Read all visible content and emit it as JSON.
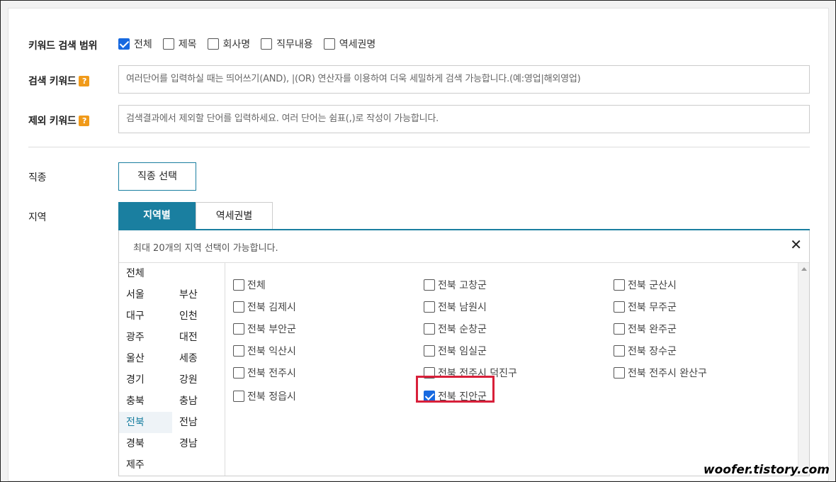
{
  "scope": {
    "label": "키워드 검색 범위",
    "options": [
      {
        "label": "전체",
        "checked": true
      },
      {
        "label": "제목",
        "checked": false
      },
      {
        "label": "회사명",
        "checked": false
      },
      {
        "label": "직무내용",
        "checked": false
      },
      {
        "label": "역세권명",
        "checked": false
      }
    ]
  },
  "search_keyword": {
    "label": "검색 키워드",
    "help": "?",
    "placeholder": "여러단어를 입력하실 때는 띄어쓰기(AND), |(OR) 연산자를 이용하여 더욱 세밀하게 검색 가능합니다.(예:영업|해외영업)"
  },
  "exclude_keyword": {
    "label": "제외 키워드",
    "help": "?",
    "placeholder": "검색결과에서 제외할 단어를 입력하세요. 여러 단어는 쉼표(,)로 작성이 가능합니다."
  },
  "job": {
    "label": "직종",
    "button": "직종 선택"
  },
  "region": {
    "label": "지역",
    "tabs": [
      "지역별",
      "역세권별"
    ],
    "notice": "최대 20개의 지역 선택이 가능합니다.",
    "close": "✕",
    "provinces": [
      "전체",
      "서울",
      "부산",
      "대구",
      "인천",
      "광주",
      "대전",
      "울산",
      "세종",
      "경기",
      "강원",
      "충북",
      "충남",
      "전북",
      "전남",
      "경북",
      "경남",
      "제주"
    ],
    "selected_province": "전북",
    "districts": [
      {
        "label": "전체",
        "checked": false
      },
      {
        "label": "전북 고창군",
        "checked": false
      },
      {
        "label": "전북 군산시",
        "checked": false
      },
      {
        "label": "전북 김제시",
        "checked": false
      },
      {
        "label": "전북 남원시",
        "checked": false
      },
      {
        "label": "전북 무주군",
        "checked": false
      },
      {
        "label": "전북 부안군",
        "checked": false
      },
      {
        "label": "전북 순창군",
        "checked": false
      },
      {
        "label": "전북 완주군",
        "checked": false
      },
      {
        "label": "전북 익산시",
        "checked": false
      },
      {
        "label": "전북 임실군",
        "checked": false
      },
      {
        "label": "전북 장수군",
        "checked": false
      },
      {
        "label": "전북 전주시",
        "checked": false
      },
      {
        "label": "전북 전주시 덕진구",
        "checked": false
      },
      {
        "label": "전북 전주시 완산구",
        "checked": false
      },
      {
        "label": "전북 정읍시",
        "checked": false
      },
      {
        "label": "전북 진안군",
        "checked": true
      }
    ]
  },
  "watermark": "woofer.tistory.com",
  "colors": {
    "accent": "#1a7fa0",
    "checkbox": "#1769e0",
    "highlight": "#d8203a",
    "help": "#f09a1a"
  }
}
